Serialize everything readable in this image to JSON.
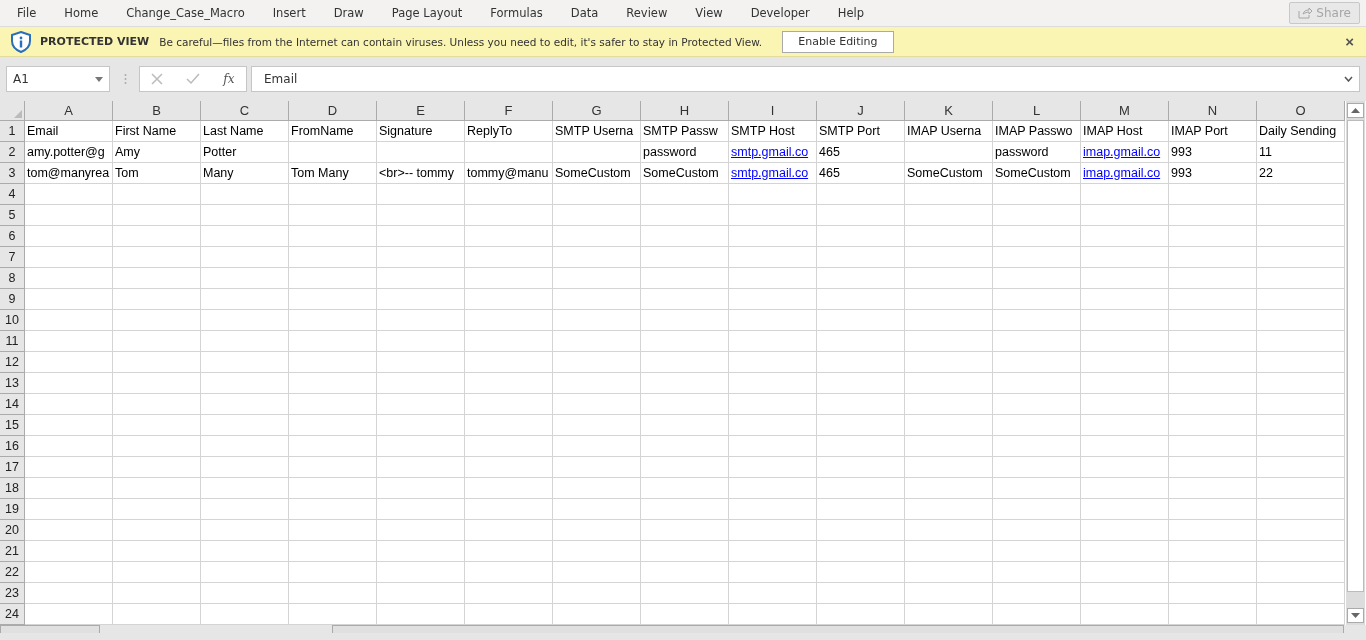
{
  "menu": [
    {
      "label": "File"
    },
    {
      "label": "Home"
    },
    {
      "label": "Change_Case_Macro"
    },
    {
      "label": "Insert"
    },
    {
      "label": "Draw"
    },
    {
      "label": "Page Layout"
    },
    {
      "label": "Formulas"
    },
    {
      "label": "Data"
    },
    {
      "label": "Review"
    },
    {
      "label": "View"
    },
    {
      "label": "Developer"
    },
    {
      "label": "Help"
    }
  ],
  "share_button": {
    "label": "Share",
    "disabled": true
  },
  "protected_view": {
    "title": "PROTECTED VIEW",
    "message": "Be careful—files from the Internet can contain viruses. Unless you need to edit, it's safer to stay in Protected View.",
    "button": "Enable Editing",
    "close": "×"
  },
  "formula_bar": {
    "name_box": "A1",
    "function_label": "fx",
    "value": "Email"
  },
  "columns": [
    "A",
    "B",
    "C",
    "D",
    "E",
    "F",
    "G",
    "H",
    "I",
    "J",
    "K",
    "L",
    "M",
    "N",
    "O"
  ],
  "row_numbers": [
    "1",
    "2",
    "3",
    "4",
    "5",
    "6",
    "7",
    "8",
    "9",
    "10",
    "11",
    "12",
    "13",
    "14",
    "15",
    "16",
    "17",
    "18",
    "19",
    "20",
    "21",
    "22",
    "23",
    "24"
  ],
  "rows": [
    [
      "Email",
      "First Name",
      "Last Name",
      "FromName",
      "Signature",
      "ReplyTo",
      "SMTP Userna",
      "SMTP Passw",
      "SMTP Host",
      "SMTP Port",
      "IMAP Userna",
      "IMAP Passwo",
      "IMAP Host",
      "IMAP Port",
      "Daily Sending"
    ],
    [
      "amy.potter@g",
      "Amy",
      "Potter",
      null,
      null,
      null,
      null,
      "password",
      {
        "text": "smtp.gmail.co",
        "kind": "link"
      },
      "465",
      null,
      "password",
      {
        "text": "imap.gmail.co",
        "kind": "link"
      },
      "993",
      "11"
    ],
    [
      "tom@manyrea",
      "Tom",
      "Many",
      "Tom Many",
      "<br>-- tommy",
      "tommy@manu",
      "SomeCustom",
      "SomeCustom",
      {
        "text": "smtp.gmail.co",
        "kind": "link"
      },
      "465",
      "SomeCustom",
      "SomeCustom",
      {
        "text": "imap.gmail.co",
        "kind": "link"
      },
      "993",
      "22"
    ]
  ]
}
